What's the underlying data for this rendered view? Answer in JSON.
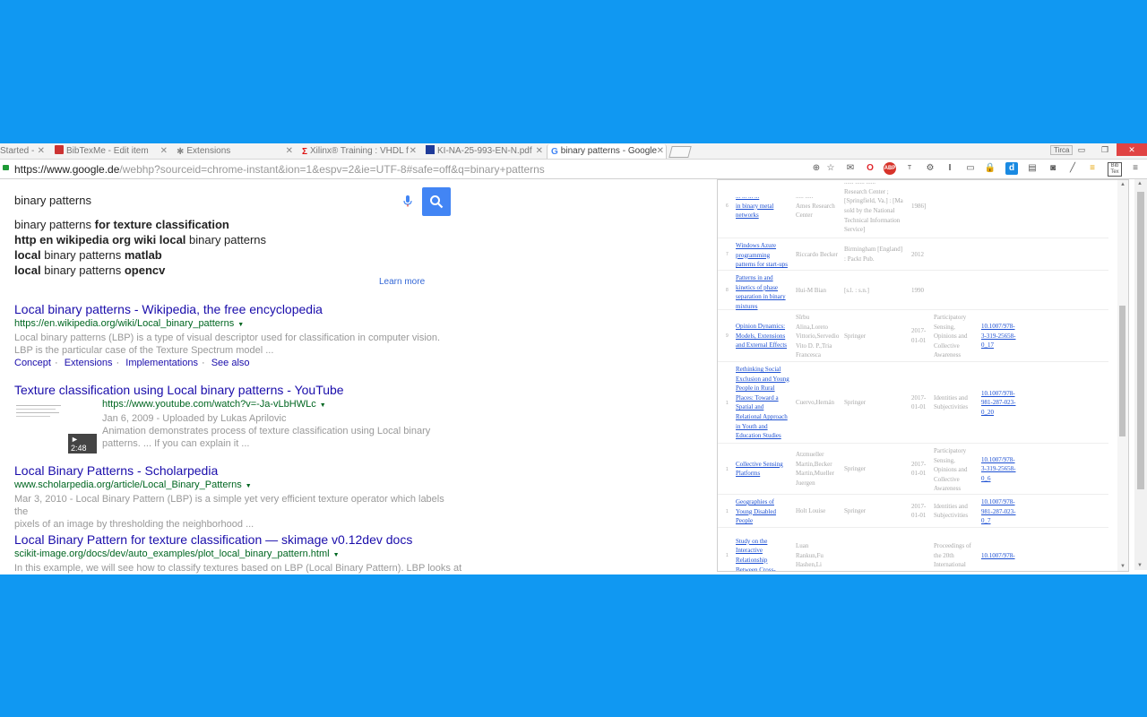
{
  "tabs": [
    {
      "label": "Started -",
      "icon": "page-icon"
    },
    {
      "label": "BibTexMe - Edit item",
      "icon": "bibtexme-icon"
    },
    {
      "label": "Extensions",
      "icon": "puzzle-icon"
    },
    {
      "label": "Xilinx® Training : VHDL f",
      "icon": "xilinx-icon"
    },
    {
      "label": "KI-NA-25-993-EN-N.pdf",
      "icon": "eu-icon"
    },
    {
      "label": "binary patterns - Google",
      "icon": "google-icon"
    }
  ],
  "window": {
    "mode_label": "Tirca",
    "minimize": "▭",
    "restore": "❐",
    "close": "✕"
  },
  "address": {
    "url_host": "https://www.google.de",
    "url_path": "/webhp?sourceid=chrome-instant&ion=1&espv=2&ie=UTF-8#safe=off&q=binary+patterns"
  },
  "search": {
    "query": "binary patterns",
    "suggestions": [
      {
        "plain": "binary patterns ",
        "bold": "for texture classification"
      },
      {
        "plain": "",
        "bold": "http en wikipedia org wiki local",
        "tail": " binary patterns"
      },
      {
        "bold": "local",
        "plain": " binary patterns ",
        "bold2": "matlab"
      },
      {
        "bold": "local",
        "plain": " binary patterns ",
        "bold2": "opencv"
      }
    ],
    "learn_more": "Learn more"
  },
  "results": [
    {
      "title": "Local binary patterns - Wikipedia, the free encyclopedia",
      "url": "https://en.wikipedia.org/wiki/Local_binary_patterns",
      "snippet1": "Local binary patterns (LBP) is a type of visual descriptor used for classification in computer vision.",
      "snippet2": "LBP is the particular case of the Texture Spectrum model ...",
      "links": [
        "Concept",
        "Extensions",
        "Implementations",
        "See also"
      ],
      "link_sep": "·"
    },
    {
      "title": "Texture classification using Local binary patterns - YouTube",
      "url": "https://www.youtube.com/watch?v=-Ja-vLbHWLc",
      "snippet1": "Jan 6, 2009 - Uploaded by Lukas Aprilovic",
      "snippet2": "Animation demonstrates process of texture classification using Local binary",
      "snippet3": "patterns. ... If you can explain it ...",
      "duration": "► 2:48"
    },
    {
      "title": "Local Binary Patterns - Scholarpedia",
      "url": "www.scholarpedia.org/article/Local_Binary_Patterns",
      "snippet1": "Mar 3, 2010 - Local Binary Pattern (LBP) is a simple yet very efficient texture operator which labels the",
      "snippet2": "pixels of an image by thresholding the neighborhood ..."
    },
    {
      "title": "Local Binary Pattern for texture classification — skimage v0.12dev docs",
      "url": "scikit-image.org/docs/dev/auto_examples/plot_local_binary_pattern.html",
      "snippet1": "In this example, we will see how to classify textures based on LBP (Local Binary Pattern). LBP looks at"
    }
  ],
  "panel": {
    "rows": [
      {
        "num": "6",
        "title": [
          "... ... ... ...",
          "in binary metal",
          "networks"
        ],
        "authors": [
          "..... .....",
          "Ames Research",
          "Center"
        ],
        "publisher": [
          "...... ...... ......",
          "Research Center ;",
          "[Springfield, Va.] : [Ma",
          "sold by the National",
          "Technical Information",
          "Service]"
        ],
        "year": "1986]",
        "subject": [],
        "doi": []
      },
      {
        "num": "7",
        "title": [
          "Windows Azure",
          "programming",
          "patterns for start-ups"
        ],
        "authors": [
          "Riccardo Becker"
        ],
        "publisher": [
          "Birmingham [England]",
          ": Packt Pub."
        ],
        "year": "2012",
        "subject": [],
        "doi": []
      },
      {
        "num": "8",
        "title": [
          "Patterns in and",
          "kinetics of phase",
          "separation in binary",
          "mixtures"
        ],
        "authors": [
          "Hui-M Bian"
        ],
        "publisher": [
          "[s.l. : s.n.]"
        ],
        "year": "1990",
        "subject": [],
        "doi": []
      },
      {
        "num": "9",
        "title": [
          "Opinion Dynamics:",
          "Models, Extensions",
          "and External Effects"
        ],
        "authors": [
          "Sîrbu",
          "Alina,Loreto",
          "Vittorio,Servedio",
          "Vito D. P.,Tria",
          "Francesca"
        ],
        "publisher": [
          "Springer"
        ],
        "year": "2017-\n01-01",
        "subject": [
          "Participatory",
          "Sensing,",
          "Opinions and",
          "Collective",
          "Awareness"
        ],
        "doi": [
          "10.1007/978-",
          "3-319-25658-",
          "0_17"
        ]
      },
      {
        "num": "1",
        "title": [
          "Rethinking Social",
          "Exclusion and Young",
          "People in Rural",
          "Places: Toward a",
          "Spatial and",
          "Relational Approach",
          "in Youth and",
          "Education Studies"
        ],
        "authors": [
          "Cuervo,Hernán"
        ],
        "publisher": [
          "Springer"
        ],
        "year": "2017-\n01-01",
        "subject": [
          "Identities and",
          "Subjectivities"
        ],
        "doi": [
          "10.1007/978-",
          "981-287-023-",
          "0_20"
        ]
      },
      {
        "num": "1",
        "title": [
          "Collective Sensing",
          "Platforms"
        ],
        "authors": [
          "Atzmueller",
          "Martin,Becker",
          "Martin,Mueller",
          "Juergen"
        ],
        "publisher": [
          "Springer"
        ],
        "year": "2017-\n01-01",
        "subject": [
          "Participatory",
          "Sensing,",
          "Opinions and",
          "Collective",
          "Awareness"
        ],
        "doi": [
          "10.1007/978-",
          "3-319-25658-",
          "0_6"
        ]
      },
      {
        "num": "1",
        "title": [
          "Geographies of",
          "Young Disabled",
          "People"
        ],
        "authors": [
          "Holt Louise"
        ],
        "publisher": [
          "Springer"
        ],
        "year": "2017-\n01-01",
        "subject": [
          "Identities and",
          "Subjectivities"
        ],
        "doi": [
          "10.1007/978-",
          "981-287-023-",
          "0_7"
        ]
      },
      {
        "num": "1",
        "title": [
          "Study on the",
          "Interactive",
          "Relationship",
          "Between Cross-"
        ],
        "authors": [
          "Luan",
          "Rankun,Fu",
          "Hashen,Li"
        ],
        "publisher": [],
        "year": "",
        "subject": [
          "Proceedings of",
          "the 20th",
          "International"
        ],
        "doi": [
          "10.1007/978-"
        ]
      }
    ]
  }
}
